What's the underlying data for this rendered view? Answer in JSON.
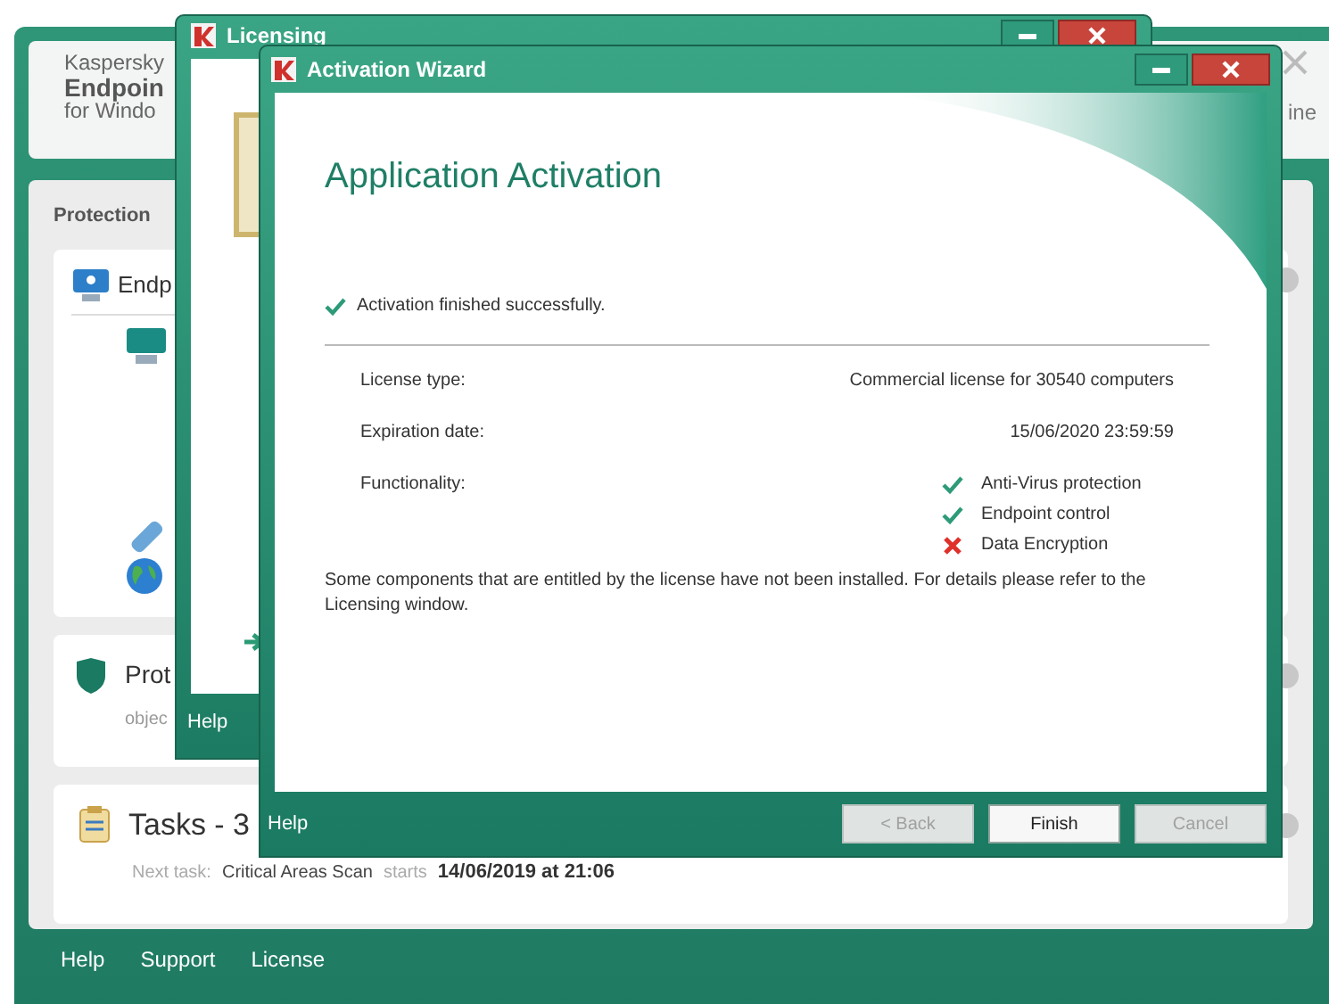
{
  "main_window": {
    "brand": [
      "Kaspersky",
      "Endpoin",
      "for Windo"
    ],
    "header_right": "ine",
    "section_title": "Protection",
    "cards": [
      {
        "kind": "endpoint",
        "title": "Endp"
      },
      {
        "kind": "protection",
        "title": "Prot",
        "subtitle": "objec"
      },
      {
        "kind": "tasks",
        "title": "Tasks - 3",
        "next_task_label": "Next task:",
        "next_task": "Critical Areas Scan",
        "starts_label": "starts",
        "starts_time": "14/06/2019 at 21:06"
      }
    ],
    "footer_links": [
      "Help",
      "Support",
      "License"
    ]
  },
  "licensing_window": {
    "title": "Licensing",
    "help": "Help"
  },
  "wizard": {
    "title": "Activation Wizard",
    "heading": "Application Activation",
    "status": "Activation finished successfully.",
    "fields": [
      {
        "label": "License type:",
        "value": "Commercial license for 30540 computers"
      },
      {
        "label": "Expiration date:",
        "value": "15/06/2020 23:59:59"
      }
    ],
    "functionality_label": "Functionality:",
    "functionality": [
      {
        "name": "Anti-Virus protection",
        "available": true
      },
      {
        "name": "Endpoint control",
        "available": true
      },
      {
        "name": "Data Encryption",
        "available": false
      }
    ],
    "note": "Some components that are entitled by the license have not been installed. For details please refer to the Licensing window.",
    "help": "Help",
    "buttons": [
      {
        "label": "< Back",
        "disabled": true
      },
      {
        "label": "Finish",
        "disabled": false
      },
      {
        "label": "Cancel",
        "disabled": true
      }
    ]
  }
}
